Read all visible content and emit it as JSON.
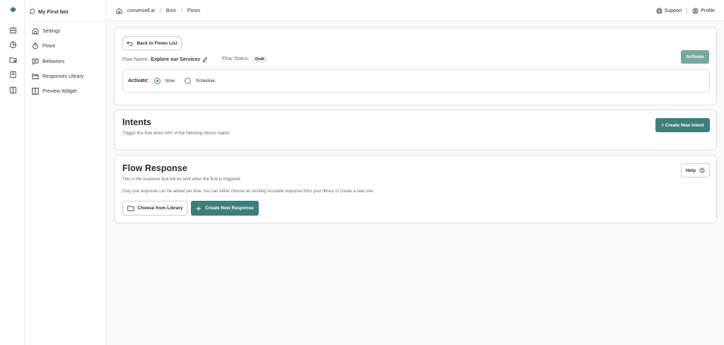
{
  "sidebar": {
    "bot_name": "My First bot",
    "items": [
      {
        "label": "Settings",
        "icon": "settings-icon"
      },
      {
        "label": "Flows",
        "icon": "flows-icon"
      },
      {
        "label": "Behaviors",
        "icon": "behaviors-icon"
      },
      {
        "label": "Responses Library",
        "icon": "folder-icon"
      },
      {
        "label": "Preview Widget",
        "icon": "preview-icon"
      }
    ]
  },
  "topbar": {
    "breadcrumb": [
      "conversell.ai",
      "Bots",
      "Flows"
    ],
    "separator": "/",
    "support_label": "Support",
    "profile_label": "Profile"
  },
  "flow": {
    "back_label": "Back to Flows List",
    "name_label": "Flow Name:",
    "name_value": "Explore our Services",
    "status_label": "Flow Status:",
    "status_value": "Draft",
    "activate_button": "Activate",
    "activate_label": "Activate:",
    "option_now": "Now",
    "option_schedule": "Schedule",
    "selected_option": "Now"
  },
  "intents": {
    "title": "Intents",
    "description": "Trigger this flow when ANY of the following Intents match:",
    "create_button": "+ Create New Intent"
  },
  "response": {
    "title": "Flow Response",
    "description": "This is the response that will be sent when the flow is triggered.",
    "note": "Only one response can be added per flow. You can either choose an existing reusable response from your library or create a new one.",
    "help_label": "Help",
    "choose_button": "Choose from Library",
    "create_button": "Create New Response"
  },
  "colors": {
    "accent": "#3f7f79",
    "accent_disabled": "#76a7a3",
    "border": "#dedee2",
    "background": "#fafafb"
  }
}
